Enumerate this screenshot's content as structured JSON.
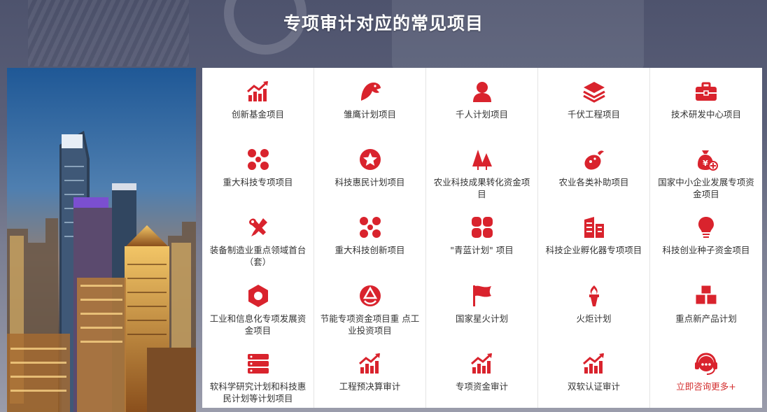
{
  "page": {
    "title": "专项审计对应的常见项目"
  },
  "colors": {
    "accent": "#d9232d",
    "text": "#333333",
    "link": "#d32d2d"
  },
  "items": [
    {
      "label": "创新基金项目",
      "icon": "chart-up-icon"
    },
    {
      "label": "雏鹰计划项目",
      "icon": "eagle-icon"
    },
    {
      "label": "千人计划项目",
      "icon": "person-icon"
    },
    {
      "label": "千伏工程项目",
      "icon": "layers-icon"
    },
    {
      "label": "技术研发中心项目",
      "icon": "toolbox-icon"
    },
    {
      "label": "重大科技专项项目",
      "icon": "nodes-icon"
    },
    {
      "label": "科技惠民计划项目",
      "icon": "star-badge-icon"
    },
    {
      "label": "农业科技成果转化资金项目",
      "icon": "trees-icon"
    },
    {
      "label": "农业各类补助项目",
      "icon": "vegetable-icon"
    },
    {
      "label": "国家中小企业发展专项资金项目",
      "icon": "moneybag-icon"
    },
    {
      "label": "装备制造业重点领域首台（套）",
      "icon": "tools-icon"
    },
    {
      "label": "重大科技创新项目",
      "icon": "nodes-icon"
    },
    {
      "label": "\"青蓝计划\" 项目",
      "icon": "quad-icon"
    },
    {
      "label": "科技企业孵化器专项项目",
      "icon": "buildings-icon"
    },
    {
      "label": "科技创业种子资金项目",
      "icon": "lightbulb-icon"
    },
    {
      "label": "工业和信息化专项发展资金项目",
      "icon": "hex-nut-icon"
    },
    {
      "label": "节能专项资金项目重 点工业投资项目",
      "icon": "recycle-icon"
    },
    {
      "label": "国家星火计划",
      "icon": "flag-icon"
    },
    {
      "label": "火炬计划",
      "icon": "torch-icon"
    },
    {
      "label": "重点新产品计划",
      "icon": "boxes-icon"
    },
    {
      "label": "软科学研究计划和科技惠民计划等计划项目",
      "icon": "server-icon"
    },
    {
      "label": "工程预决算审计",
      "icon": "chart-up-icon"
    },
    {
      "label": "专项资金审计",
      "icon": "chart-up-icon"
    },
    {
      "label": "双软认证审计",
      "icon": "chart-up-icon"
    },
    {
      "label": "立即咨询更多+",
      "icon": "headset-icon",
      "highlight": true
    }
  ]
}
